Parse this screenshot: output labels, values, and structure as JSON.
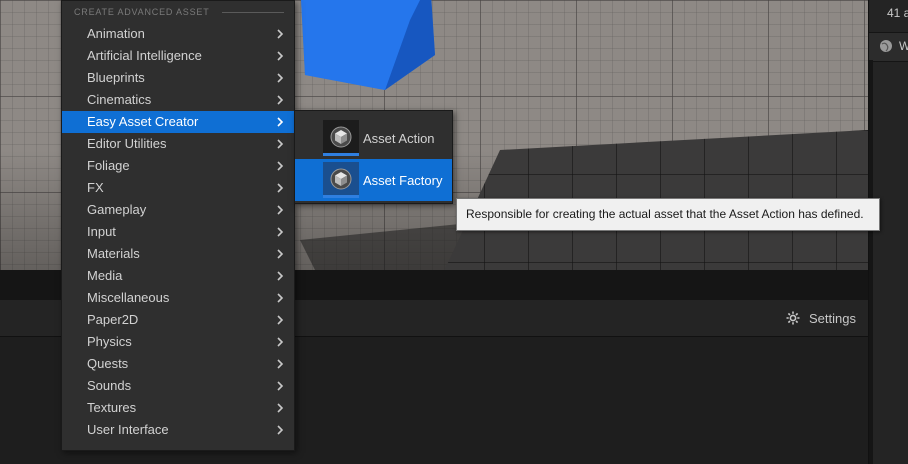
{
  "context_menu": {
    "header": "CREATE ADVANCED ASSET",
    "items": [
      {
        "label": "Animation"
      },
      {
        "label": "Artificial Intelligence"
      },
      {
        "label": "Blueprints"
      },
      {
        "label": "Cinematics"
      },
      {
        "label": "Easy Asset Creator",
        "selected": true
      },
      {
        "label": "Editor Utilities"
      },
      {
        "label": "Foliage"
      },
      {
        "label": "FX"
      },
      {
        "label": "Gameplay"
      },
      {
        "label": "Input"
      },
      {
        "label": "Materials"
      },
      {
        "label": "Media"
      },
      {
        "label": "Miscellaneous"
      },
      {
        "label": "Paper2D"
      },
      {
        "label": "Physics"
      },
      {
        "label": "Quests"
      },
      {
        "label": "Sounds"
      },
      {
        "label": "Textures"
      },
      {
        "label": "User Interface"
      }
    ],
    "arrow_icon": "chevron-right-icon"
  },
  "submenu": {
    "items": [
      {
        "label": "Asset Action",
        "icon": "cube-asset-icon"
      },
      {
        "label": "Asset Factory",
        "icon": "cube-asset-icon",
        "selected": true
      }
    ]
  },
  "tooltip": {
    "text": "Responsible for creating the actual asset that the Asset Action has defined."
  },
  "lower_toolbar": {
    "settings_label": "Settings",
    "settings_icon": "gear-icon"
  },
  "right_panel": {
    "count_text": "41 a",
    "row_label": "W",
    "row_icon": "globe-icon"
  },
  "colors": {
    "selection": "#0f6fd4",
    "menu_bg": "#2f2f2f",
    "cube": "#1f6fe6"
  }
}
